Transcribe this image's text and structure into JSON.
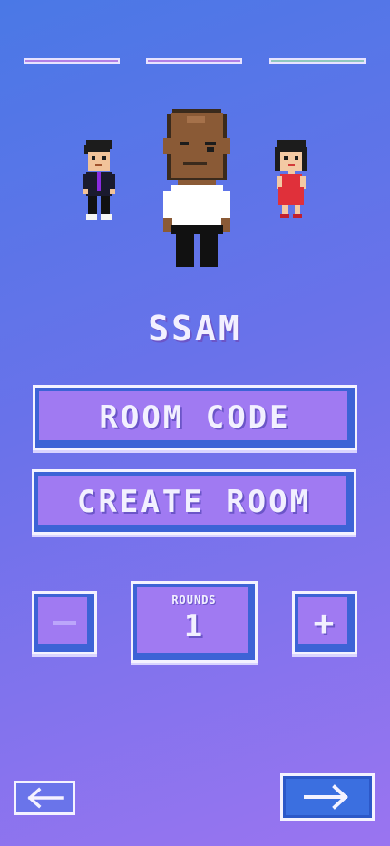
{
  "progress": {
    "steps": [
      {
        "state": "complete"
      },
      {
        "state": "complete"
      },
      {
        "state": "current"
      }
    ]
  },
  "player": {
    "name": "SSAM"
  },
  "buttons": {
    "room_code": "ROOM CODE",
    "create_room": "CREATE ROOM"
  },
  "rounds": {
    "label": "ROUNDS",
    "value": "1",
    "decrement_icon": "minus-icon",
    "increment_icon": "plus-icon"
  },
  "navigation": {
    "back_icon": "arrow-left-icon",
    "next_icon": "arrow-right-icon"
  },
  "colors": {
    "background_top": "#4a78e6",
    "background_bottom": "#9a74f0",
    "button_fill": "#a07af2",
    "button_border": "#3d63d6",
    "next_button": "#3b6fe0"
  }
}
